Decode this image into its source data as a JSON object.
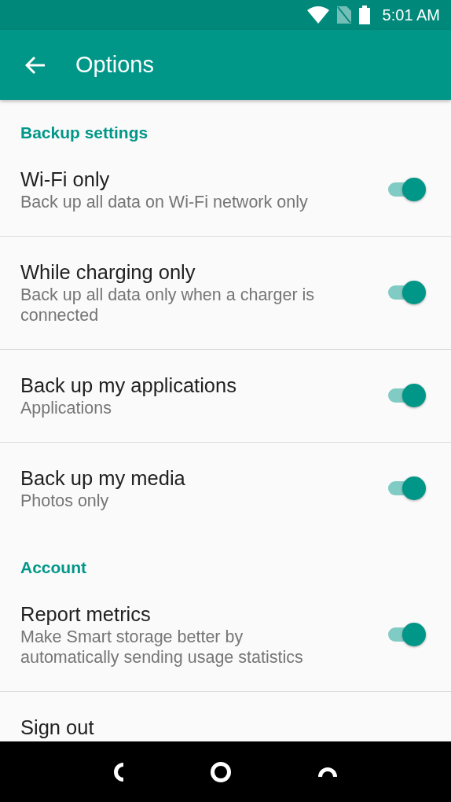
{
  "status_bar": {
    "time": "5:01 AM"
  },
  "app_bar": {
    "title": "Options"
  },
  "sections": [
    {
      "header": "Backup settings",
      "items": [
        {
          "title": "Wi-Fi only",
          "subtitle": "Back up all data on Wi-Fi network only",
          "on": true
        },
        {
          "title": "While charging only",
          "subtitle": "Back up all data only when a charger is connected",
          "on": true
        },
        {
          "title": "Back up my applications",
          "subtitle": "Applications",
          "on": true
        },
        {
          "title": "Back up my media",
          "subtitle": "Photos only",
          "on": true
        }
      ]
    },
    {
      "header": "Account",
      "items": [
        {
          "title": "Report metrics",
          "subtitle": "Make Smart storage better by automatically sending usage statistics",
          "on": true
        },
        {
          "title": "Sign out"
        }
      ]
    }
  ]
}
